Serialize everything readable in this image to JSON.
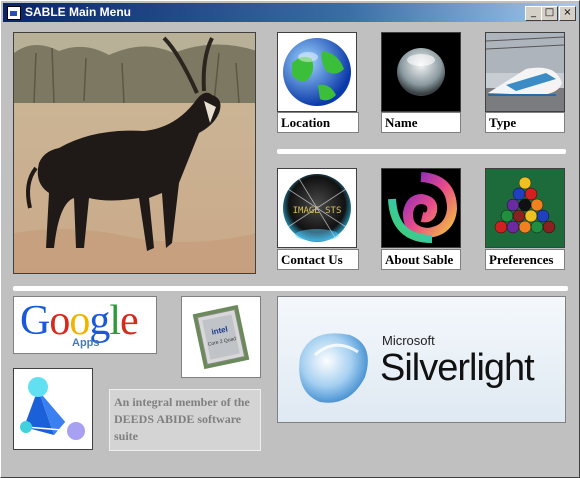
{
  "window": {
    "title": "SABLE Main Menu"
  },
  "menu_buttons": [
    {
      "id": "location",
      "label": "Location"
    },
    {
      "id": "name",
      "label": "Name"
    },
    {
      "id": "type",
      "label": "Type"
    },
    {
      "id": "contact",
      "label": "Contact Us"
    },
    {
      "id": "about",
      "label": "About Sable"
    },
    {
      "id": "preferences",
      "label": "Preferences"
    }
  ],
  "google_logo": {
    "text": "Google",
    "sub": "Apps"
  },
  "cpu_badge": {
    "brand": "intel",
    "model": "Core 2 Quad"
  },
  "images_badge": {
    "text": "IMAGE STS"
  },
  "silverlight": {
    "brand": "Microsoft",
    "name": "Silverlight"
  },
  "tagline": "An integral member of the DEEDS ABIDE software suite",
  "colors": {
    "title_gradient_start": "#0a246a",
    "title_gradient_end": "#a6caf0",
    "window_bg": "#c0c0c0"
  }
}
